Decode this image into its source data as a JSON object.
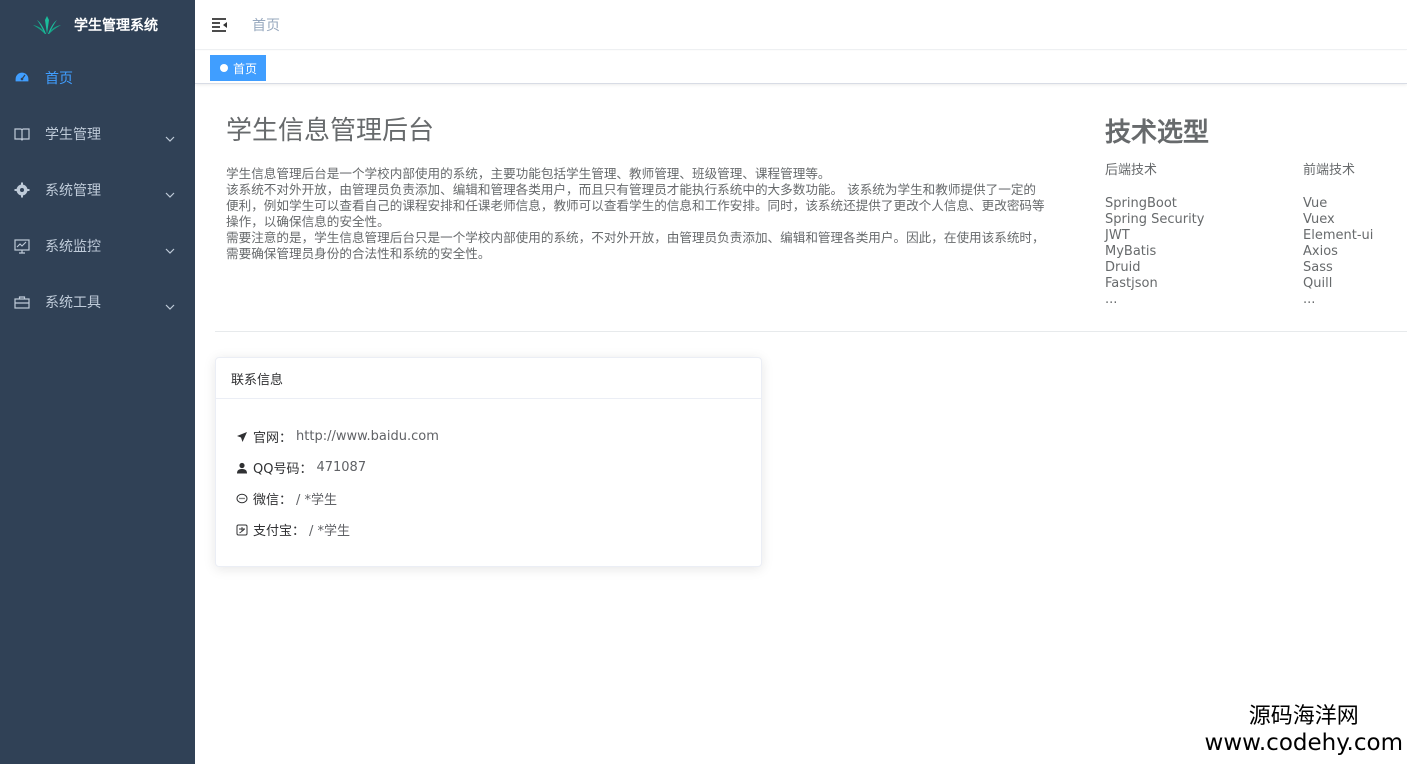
{
  "app": {
    "title": "学生管理系统"
  },
  "sidebar": {
    "items": [
      {
        "label": "首页",
        "icon": "dashboard-icon",
        "active": true
      },
      {
        "label": "学生管理",
        "icon": "book-icon"
      },
      {
        "label": "系统管理",
        "icon": "gear-icon"
      },
      {
        "label": "系统监控",
        "icon": "monitor-icon"
      },
      {
        "label": "系统工具",
        "icon": "toolbox-icon"
      }
    ]
  },
  "navbar": {
    "breadcrumb": "首页"
  },
  "tags": [
    {
      "label": "首页",
      "active": true
    }
  ],
  "intro": {
    "title": "学生信息管理后台",
    "paragraphs": [
      "学生信息管理后台是一个学校内部使用的系统，主要功能包括学生管理、教师管理、班级管理、课程管理等。",
      "该系统不对外开放，由管理员负责添加、编辑和管理各类用户，而且只有管理员才能执行系统中的大多数功能。 该系统为学生和教师提供了一定的便利，例如学生可以查看自己的课程安排和任课老师信息，教师可以查看学生的信息和工作安排。同时，该系统还提供了更改个人信息、更改密码等操作，以确保信息的安全性。",
      "需要注意的是，学生信息管理后台只是一个学校内部使用的系统，不对外开放，由管理员负责添加、编辑和管理各类用户。因此，在使用该系统时，需要确保管理员身份的合法性和系统的安全性。"
    ]
  },
  "tech": {
    "title": "技术选型",
    "backend": {
      "heading": "后端技术",
      "items": [
        "SpringBoot",
        "Spring Security",
        "JWT",
        "MyBatis",
        "Druid",
        "Fastjson",
        "..."
      ]
    },
    "frontend": {
      "heading": "前端技术",
      "items": [
        "Vue",
        "Vuex",
        "Element-ui",
        "Axios",
        "Sass",
        "Quill",
        "..."
      ]
    }
  },
  "contact": {
    "header": "联系信息",
    "rows": [
      {
        "icon": "send-icon",
        "label": "官网：",
        "value": "http://www.baidu.com"
      },
      {
        "icon": "user-icon",
        "label": "QQ号码：",
        "value": "471087"
      },
      {
        "icon": "chat-icon",
        "label": "微信：",
        "value": "/ *学生"
      },
      {
        "icon": "alipay-icon",
        "label": "支付宝：",
        "value": "/ *学生"
      }
    ]
  },
  "watermark": {
    "cn": "源码海洋网",
    "url": "www.codehy.com"
  },
  "colors": {
    "sidebar_bg": "#304156",
    "sidebar_text": "#bfcbd9",
    "accent": "#409eff"
  }
}
